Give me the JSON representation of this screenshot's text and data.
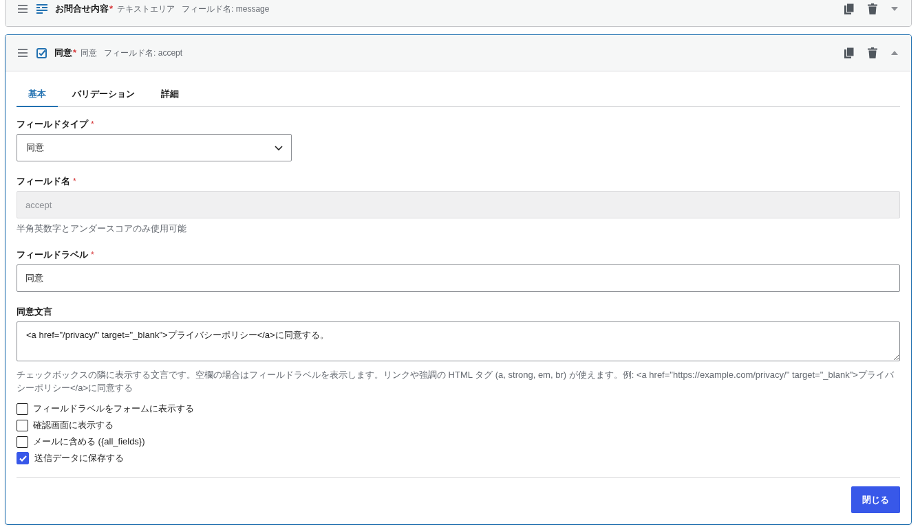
{
  "fields": [
    {
      "kind": "textarea",
      "title": "お問合せ内容",
      "required_mark": "*",
      "type_label": "テキストエリア",
      "name_label": "フィールド名: message",
      "expanded": false
    },
    {
      "kind": "checkbox",
      "title": "同意",
      "required_mark": "*",
      "type_label": "同意",
      "name_label": "フィールド名: accept",
      "expanded": true,
      "editor": {
        "tabs": [
          {
            "label": "基本",
            "selected": true
          },
          {
            "label": "バリデーション",
            "selected": false
          },
          {
            "label": "詳細",
            "selected": false
          }
        ],
        "form": [
          {
            "kind": "select",
            "label": "フィールドタイプ",
            "required_mark": "*",
            "value": "同意"
          },
          {
            "kind": "input",
            "label": "フィールド名",
            "required_mark": "*",
            "value": "accept",
            "disabled": true,
            "help": "半角英数字とアンダースコアのみ使用可能"
          },
          {
            "kind": "input",
            "label": "フィールドラベル",
            "required_mark": "*",
            "value": "同意",
            "disabled": false
          },
          {
            "kind": "textarea",
            "label": "同意文言",
            "value": "<a href=\"/privacy/\" target=\"_blank\">プライバシーポリシー</a>に同意する。",
            "help": "チェックボックスの隣に表示する文言です。空欄の場合はフィールドラベルを表示します。リンクや強調の HTML タグ (a, strong, em, br) が使えます。例: <a href=\"https://example.com/privacy/\" target=\"_blank\">プライバシーポリシー</a>に同意する"
          }
        ],
        "options": [
          {
            "label": "フィールドラベルをフォームに表示する",
            "checked": false
          },
          {
            "label": "確認画面に表示する",
            "checked": false
          },
          {
            "label": "メールに含める ({all_fields})",
            "checked": false
          },
          {
            "label": "送信データに保存する",
            "checked": true
          }
        ],
        "close_button": "閉じる"
      }
    }
  ]
}
